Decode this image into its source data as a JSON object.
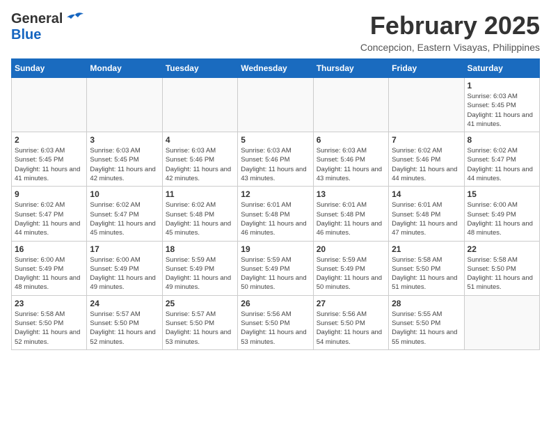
{
  "header": {
    "logo_general": "General",
    "logo_blue": "Blue",
    "month_title": "February 2025",
    "location": "Concepcion, Eastern Visayas, Philippines"
  },
  "weekdays": [
    "Sunday",
    "Monday",
    "Tuesday",
    "Wednesday",
    "Thursday",
    "Friday",
    "Saturday"
  ],
  "weeks": [
    [
      {
        "day": "",
        "empty": true
      },
      {
        "day": "",
        "empty": true
      },
      {
        "day": "",
        "empty": true
      },
      {
        "day": "",
        "empty": true
      },
      {
        "day": "",
        "empty": true
      },
      {
        "day": "",
        "empty": true
      },
      {
        "day": "1",
        "sunrise": "6:03 AM",
        "sunset": "5:45 PM",
        "daylight": "11 hours and 41 minutes."
      }
    ],
    [
      {
        "day": "2",
        "sunrise": "6:03 AM",
        "sunset": "5:45 PM",
        "daylight": "11 hours and 41 minutes."
      },
      {
        "day": "3",
        "sunrise": "6:03 AM",
        "sunset": "5:45 PM",
        "daylight": "11 hours and 42 minutes."
      },
      {
        "day": "4",
        "sunrise": "6:03 AM",
        "sunset": "5:46 PM",
        "daylight": "11 hours and 42 minutes."
      },
      {
        "day": "5",
        "sunrise": "6:03 AM",
        "sunset": "5:46 PM",
        "daylight": "11 hours and 43 minutes."
      },
      {
        "day": "6",
        "sunrise": "6:03 AM",
        "sunset": "5:46 PM",
        "daylight": "11 hours and 43 minutes."
      },
      {
        "day": "7",
        "sunrise": "6:02 AM",
        "sunset": "5:46 PM",
        "daylight": "11 hours and 44 minutes."
      },
      {
        "day": "8",
        "sunrise": "6:02 AM",
        "sunset": "5:47 PM",
        "daylight": "11 hours and 44 minutes."
      }
    ],
    [
      {
        "day": "9",
        "sunrise": "6:02 AM",
        "sunset": "5:47 PM",
        "daylight": "11 hours and 44 minutes."
      },
      {
        "day": "10",
        "sunrise": "6:02 AM",
        "sunset": "5:47 PM",
        "daylight": "11 hours and 45 minutes."
      },
      {
        "day": "11",
        "sunrise": "6:02 AM",
        "sunset": "5:48 PM",
        "daylight": "11 hours and 45 minutes."
      },
      {
        "day": "12",
        "sunrise": "6:01 AM",
        "sunset": "5:48 PM",
        "daylight": "11 hours and 46 minutes."
      },
      {
        "day": "13",
        "sunrise": "6:01 AM",
        "sunset": "5:48 PM",
        "daylight": "11 hours and 46 minutes."
      },
      {
        "day": "14",
        "sunrise": "6:01 AM",
        "sunset": "5:48 PM",
        "daylight": "11 hours and 47 minutes."
      },
      {
        "day": "15",
        "sunrise": "6:00 AM",
        "sunset": "5:49 PM",
        "daylight": "11 hours and 48 minutes."
      }
    ],
    [
      {
        "day": "16",
        "sunrise": "6:00 AM",
        "sunset": "5:49 PM",
        "daylight": "11 hours and 48 minutes."
      },
      {
        "day": "17",
        "sunrise": "6:00 AM",
        "sunset": "5:49 PM",
        "daylight": "11 hours and 49 minutes."
      },
      {
        "day": "18",
        "sunrise": "5:59 AM",
        "sunset": "5:49 PM",
        "daylight": "11 hours and 49 minutes."
      },
      {
        "day": "19",
        "sunrise": "5:59 AM",
        "sunset": "5:49 PM",
        "daylight": "11 hours and 50 minutes."
      },
      {
        "day": "20",
        "sunrise": "5:59 AM",
        "sunset": "5:49 PM",
        "daylight": "11 hours and 50 minutes."
      },
      {
        "day": "21",
        "sunrise": "5:58 AM",
        "sunset": "5:50 PM",
        "daylight": "11 hours and 51 minutes."
      },
      {
        "day": "22",
        "sunrise": "5:58 AM",
        "sunset": "5:50 PM",
        "daylight": "11 hours and 51 minutes."
      }
    ],
    [
      {
        "day": "23",
        "sunrise": "5:58 AM",
        "sunset": "5:50 PM",
        "daylight": "11 hours and 52 minutes."
      },
      {
        "day": "24",
        "sunrise": "5:57 AM",
        "sunset": "5:50 PM",
        "daylight": "11 hours and 52 minutes."
      },
      {
        "day": "25",
        "sunrise": "5:57 AM",
        "sunset": "5:50 PM",
        "daylight": "11 hours and 53 minutes."
      },
      {
        "day": "26",
        "sunrise": "5:56 AM",
        "sunset": "5:50 PM",
        "daylight": "11 hours and 53 minutes."
      },
      {
        "day": "27",
        "sunrise": "5:56 AM",
        "sunset": "5:50 PM",
        "daylight": "11 hours and 54 minutes."
      },
      {
        "day": "28",
        "sunrise": "5:55 AM",
        "sunset": "5:50 PM",
        "daylight": "11 hours and 55 minutes."
      },
      {
        "day": "",
        "empty": true
      }
    ]
  ]
}
